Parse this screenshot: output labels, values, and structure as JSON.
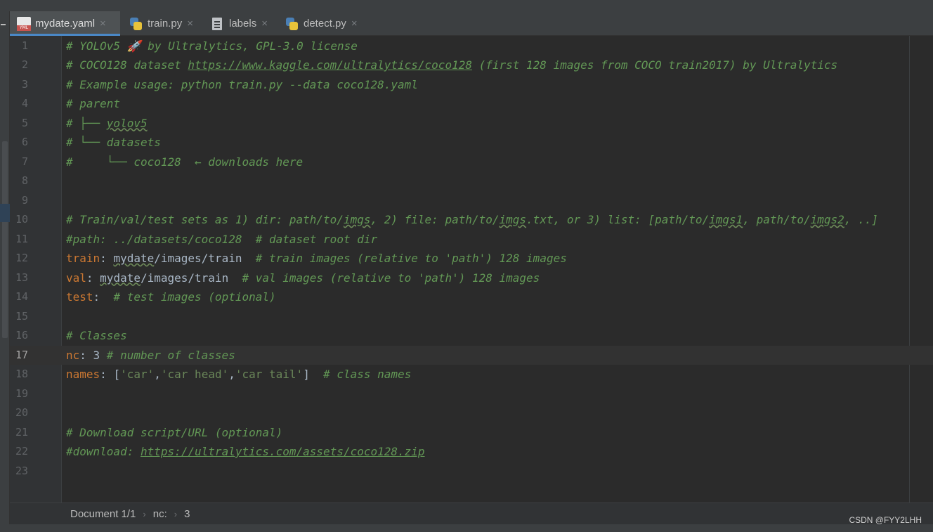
{
  "tabs": [
    {
      "label": "mydate.yaml",
      "icon": "yaml-file-icon",
      "active": true
    },
    {
      "label": "train.py",
      "icon": "python-file-icon",
      "active": false
    },
    {
      "label": "labels",
      "icon": "text-file-icon",
      "active": false
    },
    {
      "label": "detect.py",
      "icon": "python-file-icon",
      "active": false
    }
  ],
  "tab_close_glyph": "×",
  "editor": {
    "current_line": 17,
    "line_numbers": [
      "1",
      "2",
      "3",
      "4",
      "5",
      "6",
      "7",
      "8",
      "9",
      "10",
      "11",
      "12",
      "13",
      "14",
      "15",
      "16",
      "17",
      "18",
      "19",
      "20",
      "21",
      "22",
      "23"
    ],
    "lines": [
      [
        {
          "t": "# YOLOv5 🚀 by Ultralytics, GPL-3.0 license",
          "c": "c"
        }
      ],
      [
        {
          "t": "# COCO128 dataset ",
          "c": "c"
        },
        {
          "t": "https://www.kaggle.com/ultralytics/coco128",
          "c": "cu"
        },
        {
          "t": " (first 128 images from COCO train2017) by Ultralytics",
          "c": "c"
        }
      ],
      [
        {
          "t": "# Example usage: python train.py --data coco128.yaml",
          "c": "c"
        }
      ],
      [
        {
          "t": "# parent",
          "c": "c"
        }
      ],
      [
        {
          "t": "# ├── ",
          "c": "c"
        },
        {
          "t": "yolov5",
          "c": "cw"
        }
      ],
      [
        {
          "t": "# └── datasets",
          "c": "c"
        }
      ],
      [
        {
          "t": "#     └── coco128  ← downloads here",
          "c": "c"
        }
      ],
      [],
      [],
      [
        {
          "t": "# Train/val/test sets as 1) dir: path/to/",
          "c": "c"
        },
        {
          "t": "imgs",
          "c": "cw"
        },
        {
          "t": ", 2) file: path/to/",
          "c": "c"
        },
        {
          "t": "imgs",
          "c": "cw"
        },
        {
          "t": ".txt, or 3) list: [path/to/",
          "c": "c"
        },
        {
          "t": "imgs1",
          "c": "cw"
        },
        {
          "t": ", path/to/",
          "c": "c"
        },
        {
          "t": "imgs2",
          "c": "cw"
        },
        {
          "t": ", ..]",
          "c": "c"
        }
      ],
      [
        {
          "t": "#path: ../datasets/coco128  # dataset root dir",
          "c": "c"
        }
      ],
      [
        {
          "t": "train",
          "c": "k"
        },
        {
          "t": ": ",
          "c": "p"
        },
        {
          "t": "mydate",
          "c": "pw"
        },
        {
          "t": "/images/train  ",
          "c": "p"
        },
        {
          "t": "# train images (relative to 'path') 128 images",
          "c": "c"
        }
      ],
      [
        {
          "t": "val",
          "c": "k"
        },
        {
          "t": ": ",
          "c": "p"
        },
        {
          "t": "mydate",
          "c": "pw"
        },
        {
          "t": "/images/train  ",
          "c": "p"
        },
        {
          "t": "# val images (relative to 'path') 128 images",
          "c": "c"
        }
      ],
      [
        {
          "t": "test",
          "c": "k"
        },
        {
          "t": ":  ",
          "c": "p"
        },
        {
          "t": "# test images (optional)",
          "c": "c"
        }
      ],
      [],
      [
        {
          "t": "# Classes",
          "c": "c"
        }
      ],
      [
        {
          "t": "nc",
          "c": "k"
        },
        {
          "t": ": 3 ",
          "c": "p"
        },
        {
          "t": "# number of classes",
          "c": "c"
        }
      ],
      [
        {
          "t": "names",
          "c": "k"
        },
        {
          "t": ": [",
          "c": "p"
        },
        {
          "t": "'car'",
          "c": "s"
        },
        {
          "t": ",",
          "c": "p"
        },
        {
          "t": "'car head'",
          "c": "s"
        },
        {
          "t": ",",
          "c": "p"
        },
        {
          "t": "'car tail'",
          "c": "s"
        },
        {
          "t": "]  ",
          "c": "p"
        },
        {
          "t": "# class names",
          "c": "c"
        }
      ],
      [],
      [],
      [
        {
          "t": "# Download script/URL (optional)",
          "c": "c"
        }
      ],
      [
        {
          "t": "#download: ",
          "c": "c"
        },
        {
          "t": "https://ultralytics.com/assets/coco128.zip",
          "c": "cu"
        }
      ],
      []
    ]
  },
  "breadcrumb": {
    "items": [
      "Document 1/1",
      "nc:",
      "3"
    ],
    "separator": "›"
  },
  "watermark": "CSDN @FYY2LHH",
  "colors": {
    "comment": "#629755",
    "key": "#cc7832",
    "string": "#6a8759",
    "plain": "#a9b7c6",
    "accent": "#4a88c7",
    "background": "#2b2b2b"
  }
}
